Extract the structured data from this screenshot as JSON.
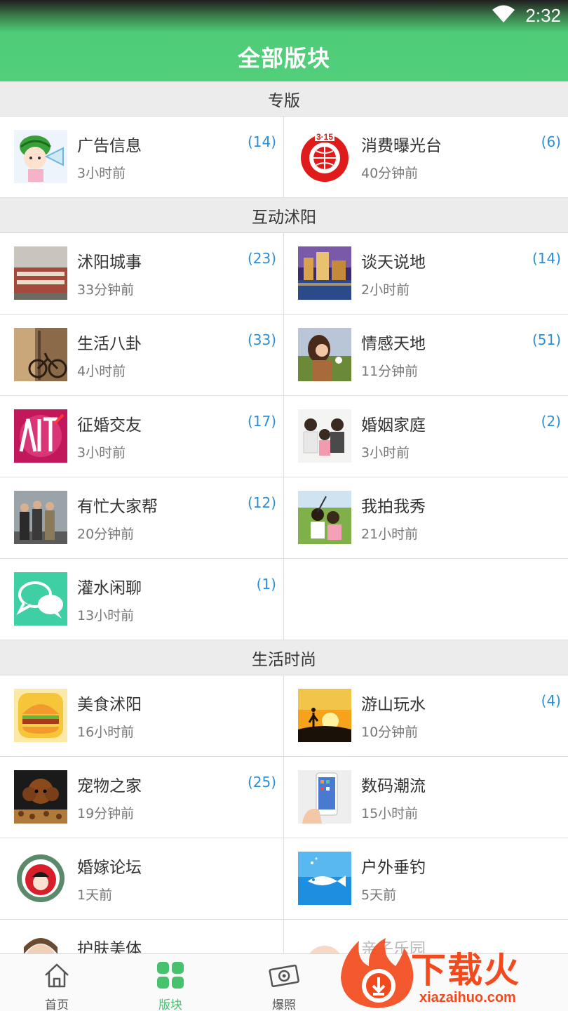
{
  "status": {
    "time": "2:32"
  },
  "header": {
    "title": "全部版块"
  },
  "sections": [
    {
      "title": "专版",
      "rows": [
        [
          {
            "name": "广告信息",
            "time": "3小时前",
            "count": "(14)",
            "icon": "watermelon-girl-icon"
          },
          {
            "name": "消费曝光台",
            "time": "40分钟前",
            "count": "(6)",
            "icon": "315-logo-icon"
          }
        ]
      ]
    },
    {
      "title": "互动沭阳",
      "rows": [
        [
          {
            "name": "沭阳城事",
            "time": "33分钟前",
            "count": "(23)",
            "icon": "city-wall-photo"
          },
          {
            "name": "谈天说地",
            "time": "2小时前",
            "count": "(14)",
            "icon": "night-city-photo"
          }
        ],
        [
          {
            "name": "生活八卦",
            "time": "4小时前",
            "count": "(33)",
            "icon": "bicycle-photo"
          },
          {
            "name": "情感天地",
            "time": "11分钟前",
            "count": "(51)",
            "icon": "girl-field-photo"
          }
        ],
        [
          {
            "name": "征婚交友",
            "time": "3小时前",
            "count": "(17)",
            "icon": "dating-poster-photo"
          },
          {
            "name": "婚姻家庭",
            "time": "3小时前",
            "count": "(2)",
            "icon": "family-photo"
          }
        ],
        [
          {
            "name": "有忙大家帮",
            "time": "20分钟前",
            "count": "(12)",
            "icon": "street-people-photo"
          },
          {
            "name": "我拍我秀",
            "time": "21小时前",
            "count": "",
            "icon": "selfie-photo"
          }
        ],
        [
          {
            "name": "灌水闲聊",
            "time": "13小时前",
            "count": "(1)",
            "icon": "chat-bubbles-icon"
          },
          null
        ]
      ]
    },
    {
      "title": "生活时尚",
      "rows": [
        [
          {
            "name": "美食沭阳",
            "time": "16小时前",
            "count": "",
            "icon": "burger-icon"
          },
          {
            "name": "游山玩水",
            "time": "10分钟前",
            "count": "(4)",
            "icon": "sunset-hiker-photo"
          }
        ],
        [
          {
            "name": "宠物之家",
            "time": "19分钟前",
            "count": "(25)",
            "icon": "poodle-photo"
          },
          {
            "name": "数码潮流",
            "time": "15小时前",
            "count": "",
            "icon": "smartphone-photo"
          }
        ],
        [
          {
            "name": "婚嫁论坛",
            "time": "1天前",
            "count": "",
            "icon": "wedding-emblem-icon"
          },
          {
            "name": "户外垂钓",
            "time": "5天前",
            "count": "",
            "icon": "fish-icon"
          }
        ],
        [
          {
            "name": "护肤美体",
            "time": "",
            "count": "",
            "icon": "face-photo"
          },
          {
            "name": "亲子乐园",
            "time": "",
            "count": "",
            "icon": "baby-photo"
          }
        ]
      ]
    }
  ],
  "bottom_nav": [
    {
      "label": "首页",
      "icon": "home-icon"
    },
    {
      "label": "版块",
      "icon": "grid-icon"
    },
    {
      "label": "爆照",
      "icon": "camera-icon"
    },
    {
      "label": "",
      "icon": "hidden"
    },
    {
      "label": "",
      "icon": "hidden"
    }
  ],
  "watermark": {
    "text": "下载火",
    "url": "xiazaihuo.com"
  },
  "colors": {
    "header_green": "#52cf7a",
    "count_blue": "#2a8fd8",
    "active_nav": "#46c26f",
    "watermark": "#f24a1d"
  }
}
